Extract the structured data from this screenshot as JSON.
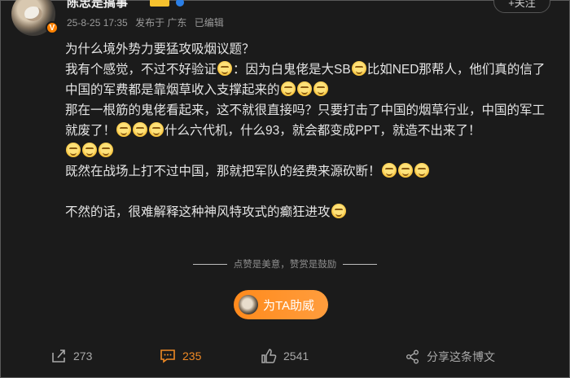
{
  "post": {
    "username": "陈忠是搞事",
    "verified_badge": "V",
    "meta": {
      "time": "25-8-25 17:35",
      "location": "发布于 广东",
      "edited": "已编辑"
    },
    "follow_label": "+关注",
    "content": {
      "p1": "为什么境外势力要猛攻吸烟议题？",
      "p2a": "我有个感觉，不过不好验证",
      "p2b": "：因为白鬼佬是大SB",
      "p2c": "比如NED那帮人，他们真的信了中国的军费都是靠烟草收入支撑起来的",
      "p3a": "那在一根筋的鬼佬看起来，这不就很直接吗？只要打击了中国的烟草行业，中国的军工就废了！",
      "p3b": "什么六代机，什么93，就会都变成PPT，就造不出来了！",
      "p4": "既然在战场上打不过中国，那就把军队的经费来源砍断！",
      "p5": "不然的话，很难解释这种神风特攻式的癫狂进攻"
    },
    "tip_text": "点赞是美意，赞赏是鼓励",
    "tip_button_label": "为TA助威",
    "actions": {
      "share_count": "273",
      "comment_count": "235",
      "like_count": "2541",
      "share_post_label": "分享这条博文"
    }
  },
  "colors": {
    "accent": "#ff8200",
    "comment": "#f08a24",
    "background": "#1b1b1b"
  },
  "icons": [
    "grin-emoji",
    "share-icon",
    "comment-icon",
    "like-icon",
    "share-post-icon"
  ]
}
